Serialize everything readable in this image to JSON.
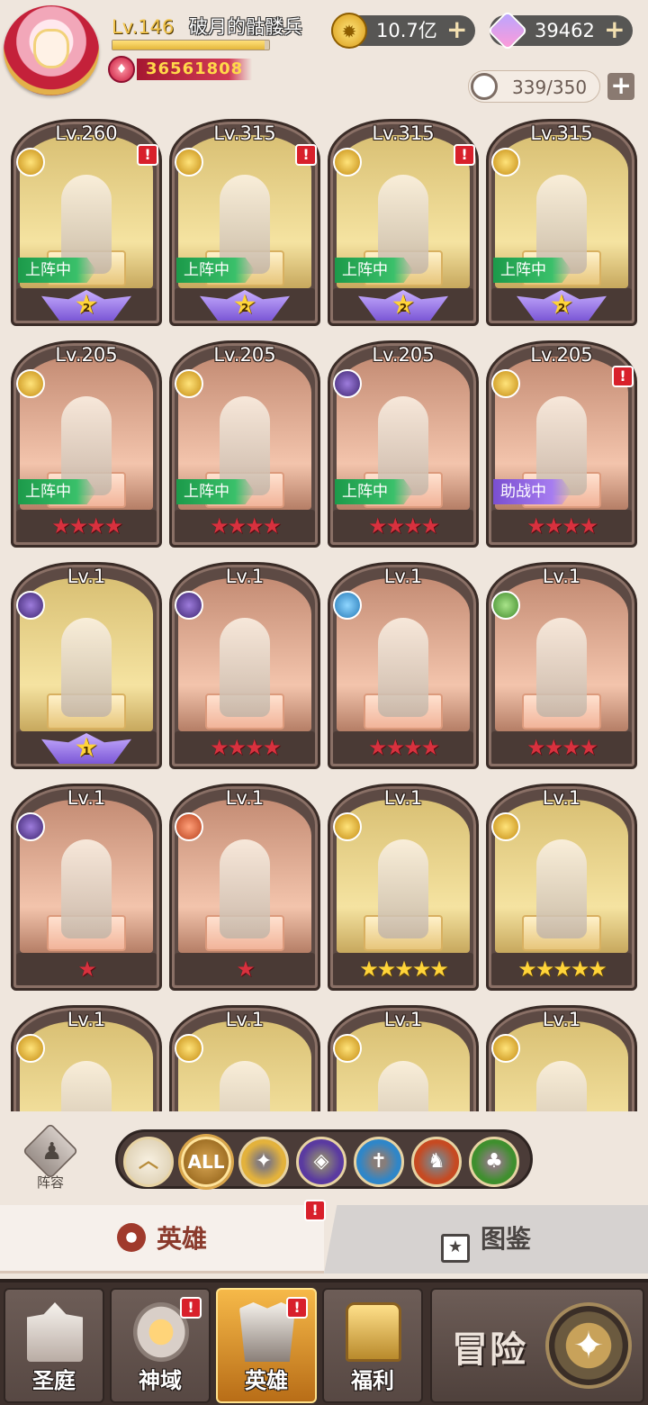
{
  "player": {
    "level": "Lv.146",
    "name": "破月的骷髅兵",
    "xp_progress": 0.97,
    "power": "36561808"
  },
  "currency": {
    "gold": "10.7亿",
    "gems": "39462",
    "plus_glyph": "+"
  },
  "capacity": {
    "value": "339/350",
    "plus_glyph": "+"
  },
  "heroes": [
    {
      "level": "Lv.260",
      "faction": "gold",
      "alert": true,
      "status": "上阵中",
      "status_type": "active",
      "rank_type": "wings",
      "rank": "2",
      "bg": "gold"
    },
    {
      "level": "Lv.315",
      "faction": "gold",
      "alert": true,
      "status": "上阵中",
      "status_type": "active",
      "rank_type": "wings",
      "rank": "2",
      "bg": "gold"
    },
    {
      "level": "Lv.315",
      "faction": "gold",
      "alert": true,
      "status": "上阵中",
      "status_type": "active",
      "rank_type": "wings",
      "rank": "2",
      "bg": "gold"
    },
    {
      "level": "Lv.315",
      "faction": "gold",
      "alert": false,
      "status": "上阵中",
      "status_type": "active",
      "rank_type": "wings",
      "rank": "2",
      "bg": "gold"
    },
    {
      "level": "Lv.205",
      "faction": "gold",
      "alert": false,
      "status": "上阵中",
      "status_type": "active",
      "rank_type": "stars",
      "stars": "★★★★",
      "star_color": "red",
      "bg": "pink"
    },
    {
      "level": "Lv.205",
      "faction": "gold",
      "alert": false,
      "status": "上阵中",
      "status_type": "active",
      "rank_type": "stars",
      "stars": "★★★★",
      "star_color": "red",
      "bg": "pink"
    },
    {
      "level": "Lv.205",
      "faction": "dark",
      "alert": false,
      "status": "上阵中",
      "status_type": "active",
      "rank_type": "stars",
      "stars": "★★★★",
      "star_color": "red",
      "bg": "pink"
    },
    {
      "level": "Lv.205",
      "faction": "gold",
      "alert": true,
      "status": "助战中",
      "status_type": "assist",
      "rank_type": "stars",
      "stars": "★★★★",
      "star_color": "red",
      "bg": "pink"
    },
    {
      "level": "Lv.1",
      "faction": "dark",
      "alert": false,
      "status": "",
      "status_type": "none",
      "rank_type": "wings",
      "rank": "1",
      "bg": "gold"
    },
    {
      "level": "Lv.1",
      "faction": "dark",
      "alert": false,
      "status": "",
      "status_type": "none",
      "rank_type": "stars",
      "stars": "★★★★",
      "star_color": "red",
      "bg": "pink"
    },
    {
      "level": "Lv.1",
      "faction": "blue",
      "alert": false,
      "status": "",
      "status_type": "none",
      "rank_type": "stars",
      "stars": "★★★★",
      "star_color": "red",
      "bg": "pink"
    },
    {
      "level": "Lv.1",
      "faction": "green",
      "alert": false,
      "status": "",
      "status_type": "none",
      "rank_type": "stars",
      "stars": "★★★★",
      "star_color": "red",
      "bg": "pink"
    },
    {
      "level": "Lv.1",
      "faction": "dark",
      "alert": false,
      "status": "",
      "status_type": "none",
      "rank_type": "stars",
      "stars": "★",
      "star_color": "red",
      "bg": "pink"
    },
    {
      "level": "Lv.1",
      "faction": "red",
      "alert": false,
      "status": "",
      "status_type": "none",
      "rank_type": "stars",
      "stars": "★",
      "star_color": "red",
      "bg": "pink"
    },
    {
      "level": "Lv.1",
      "faction": "gold",
      "alert": false,
      "status": "",
      "status_type": "none",
      "rank_type": "stars",
      "stars": "★★★★★",
      "star_color": "gold",
      "bg": "gold"
    },
    {
      "level": "Lv.1",
      "faction": "gold",
      "alert": false,
      "status": "",
      "status_type": "none",
      "rank_type": "stars",
      "stars": "★★★★★",
      "star_color": "gold",
      "bg": "gold"
    },
    {
      "level": "Lv.1",
      "faction": "gold",
      "alert": false,
      "status": "",
      "status_type": "none",
      "rank_type": "stars",
      "stars": "",
      "star_color": "gold",
      "bg": "gold"
    },
    {
      "level": "Lv.1",
      "faction": "gold",
      "alert": false,
      "status": "",
      "status_type": "none",
      "rank_type": "stars",
      "stars": "",
      "star_color": "gold",
      "bg": "gold"
    },
    {
      "level": "Lv.1",
      "faction": "gold",
      "alert": false,
      "status": "",
      "status_type": "none",
      "rank_type": "stars",
      "stars": "",
      "star_color": "gold",
      "bg": "gold"
    },
    {
      "level": "Lv.1",
      "faction": "gold",
      "alert": false,
      "status": "",
      "status_type": "none",
      "rank_type": "stars",
      "stars": "",
      "star_color": "gold",
      "bg": "gold"
    }
  ],
  "alert_glyph": "!",
  "lineup": {
    "label": "阵容",
    "icon": "pawn-icon"
  },
  "filters": [
    {
      "key": "sort",
      "glyph": "︿",
      "icon": "sort-chevron-icon"
    },
    {
      "key": "all",
      "glyph": "ALL",
      "icon": "all-filter-icon"
    },
    {
      "key": "light",
      "glyph": "✦",
      "icon": "light-faction-icon",
      "color": "#e3b23c"
    },
    {
      "key": "dark",
      "glyph": "◈",
      "icon": "dark-faction-icon",
      "color": "#5a3aa0"
    },
    {
      "key": "holy",
      "glyph": "✝",
      "icon": "holy-faction-icon",
      "color": "#2f86c8"
    },
    {
      "key": "beast",
      "glyph": "♞",
      "icon": "beast-faction-icon",
      "color": "#c64a22"
    },
    {
      "key": "nature",
      "glyph": "♣",
      "icon": "nature-faction-icon",
      "color": "#3f8f2e"
    }
  ],
  "subtabs": {
    "heroes": "英雄",
    "codex": "图鉴",
    "codex_icon_glyph": "★"
  },
  "nav": [
    {
      "label": "圣庭",
      "alert": false
    },
    {
      "label": "神域",
      "alert": true
    },
    {
      "label": "英雄",
      "alert": true,
      "active": true
    },
    {
      "label": "福利",
      "alert": false
    }
  ],
  "adventure": {
    "label": "冒险",
    "glyph": "✦"
  }
}
